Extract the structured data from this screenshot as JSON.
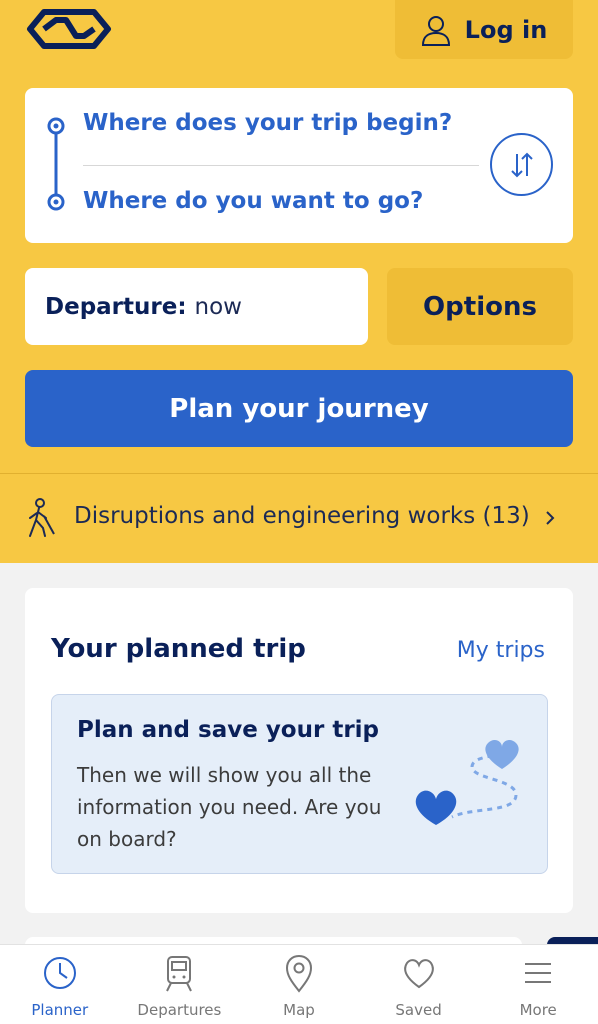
{
  "header": {
    "logo_icon": "ns-logo-icon",
    "login_label": "Log in",
    "login_icon": "user-icon"
  },
  "trip_input": {
    "from_placeholder": "Where does your trip begin?",
    "to_placeholder": "Where do you want to go?",
    "swap_icon": "swap-arrows-icon"
  },
  "departure": {
    "label": "Departure:",
    "value": "now"
  },
  "options_label": "Options",
  "plan_button_label": "Plan your journey",
  "disruptions": {
    "icon": "engineering-worker-icon",
    "text": "Disruptions and engineering works (13)"
  },
  "planned_trip": {
    "title": "Your planned trip",
    "link": "My trips",
    "promo_title": "Plan and save your trip",
    "promo_body": "Then we will show you all the information you need. Are you on board?",
    "promo_icon": "hearts-route-icon"
  },
  "tabs": [
    {
      "label": "Planner",
      "icon": "clock-icon",
      "active": true
    },
    {
      "label": "Departures",
      "icon": "train-icon",
      "active": false
    },
    {
      "label": "Map",
      "icon": "map-pin-icon",
      "active": false
    },
    {
      "label": "Saved",
      "icon": "heart-icon",
      "active": false
    },
    {
      "label": "More",
      "icon": "menu-icon",
      "active": false
    }
  ],
  "colors": {
    "brand_yellow": "#f7c843",
    "brand_blue": "#2a63c9",
    "navy": "#0a2059"
  }
}
